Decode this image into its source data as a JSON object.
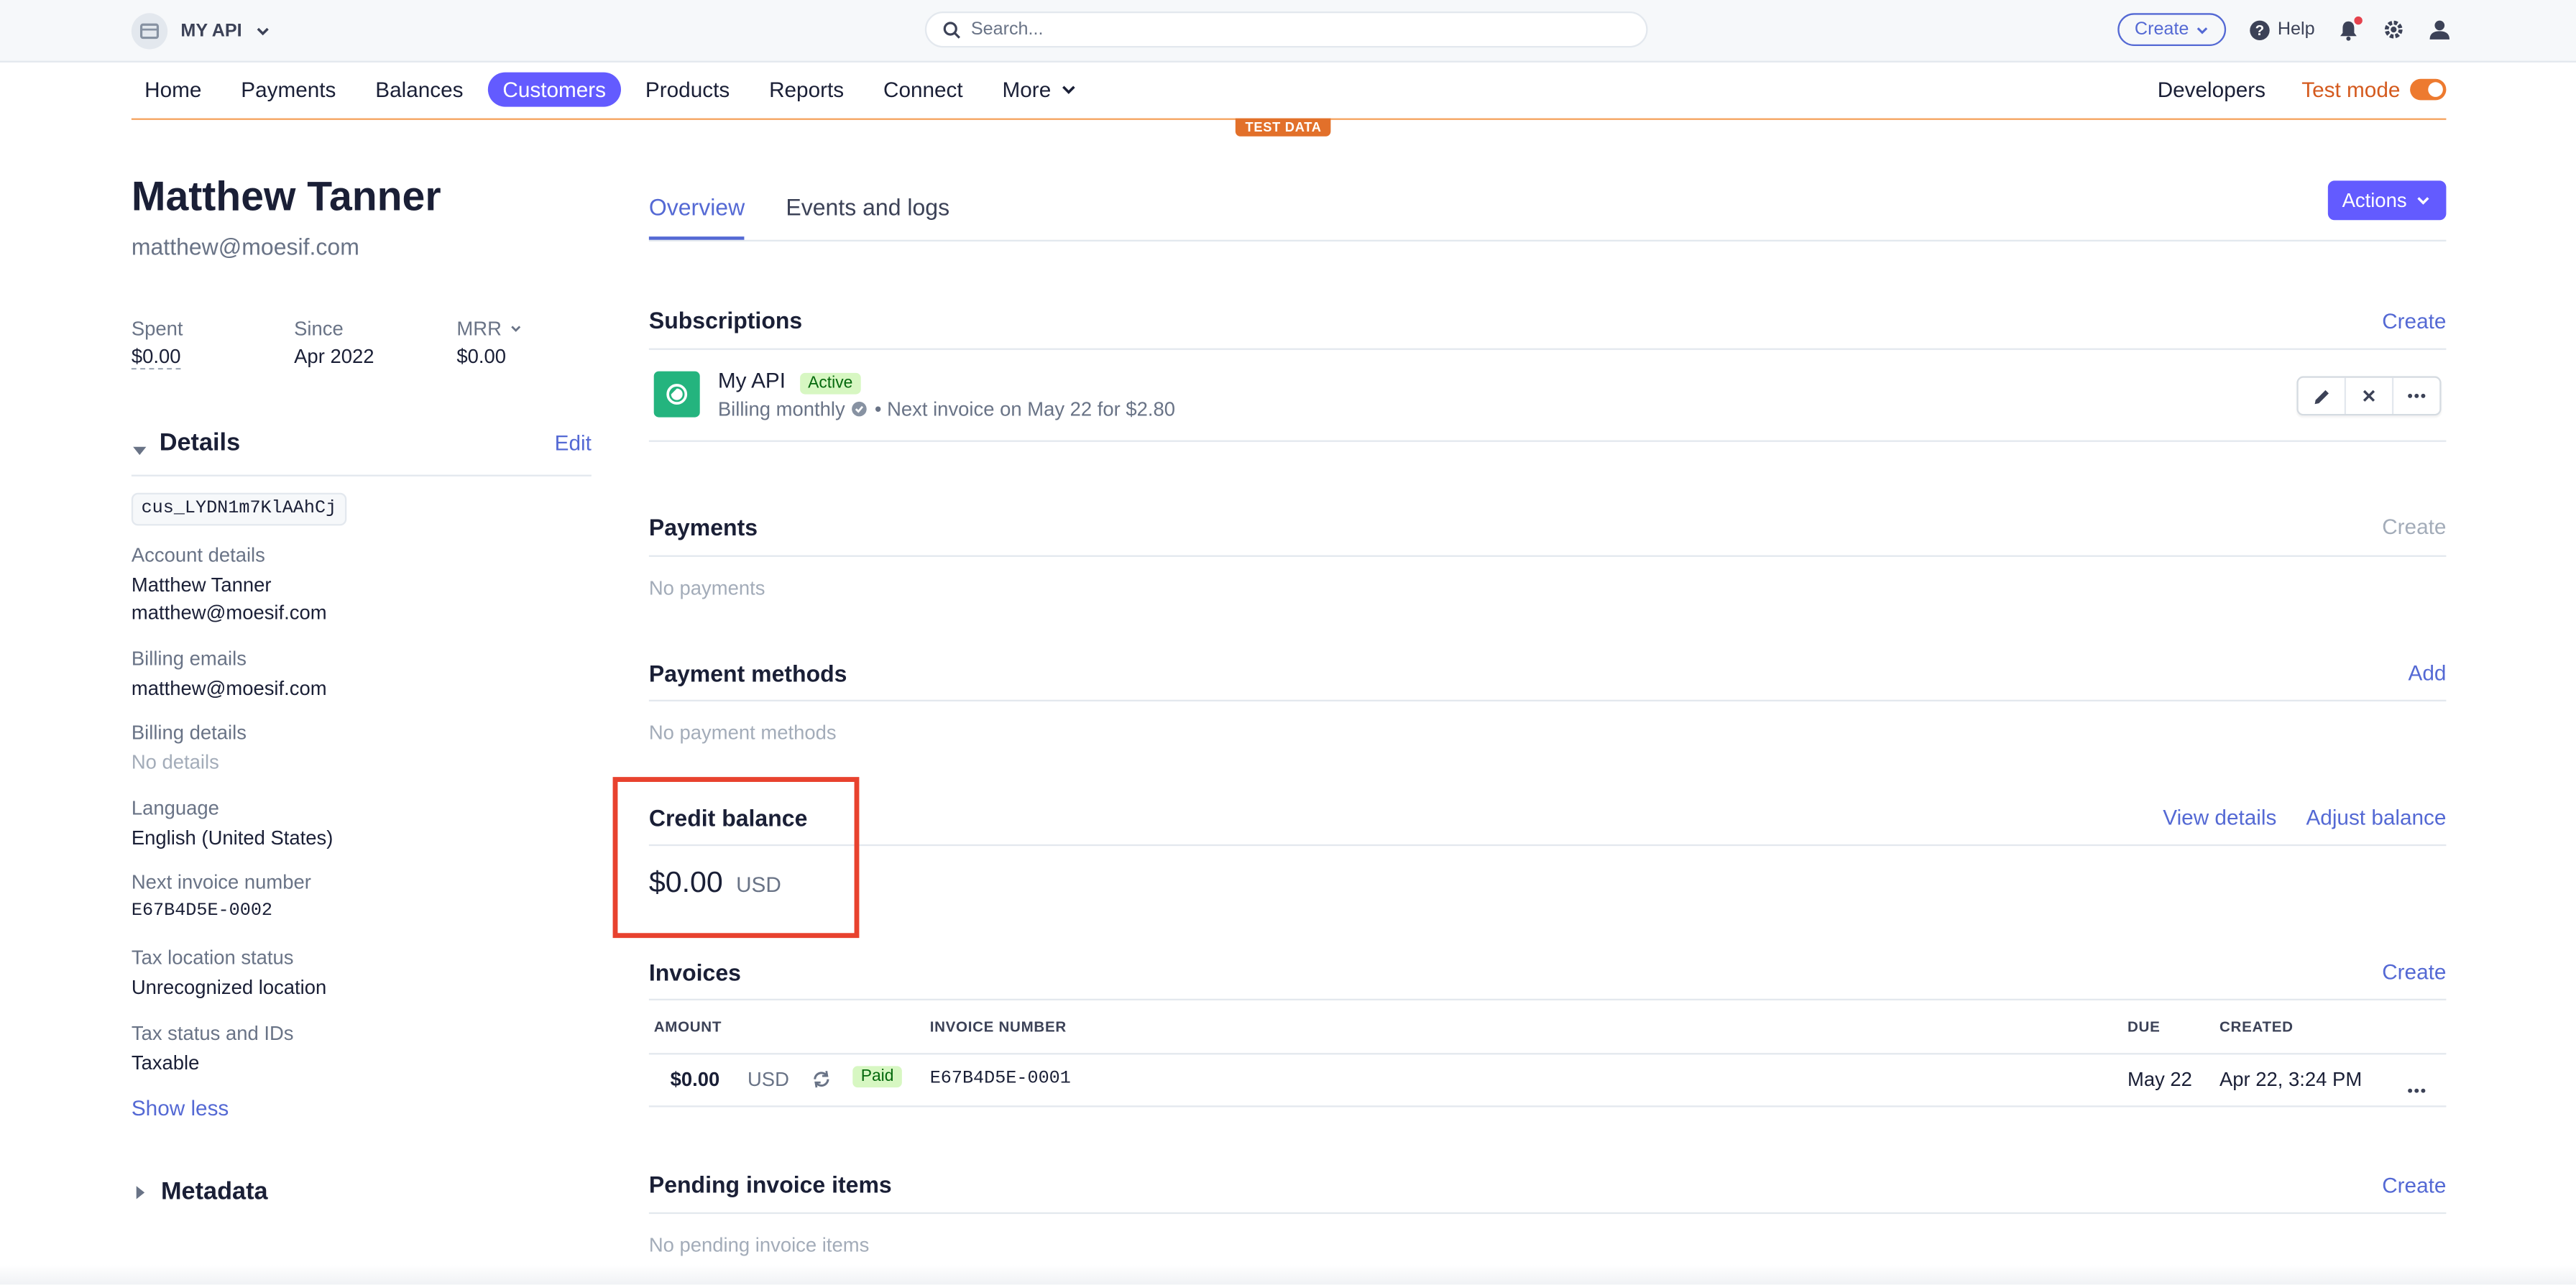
{
  "topbar": {
    "account_name": "MY API",
    "search_placeholder": "Search...",
    "create_label": "Create",
    "help_label": "Help"
  },
  "nav": {
    "items": [
      "Home",
      "Payments",
      "Balances",
      "Customers",
      "Products",
      "Reports",
      "Connect",
      "More"
    ],
    "active": "Customers",
    "developers_label": "Developers",
    "test_mode_label": "Test mode",
    "test_data_badge": "TEST DATA"
  },
  "customer": {
    "name": "Matthew Tanner",
    "email": "matthew@moesif.com",
    "stats": [
      {
        "label": "Spent",
        "value": "$0.00"
      },
      {
        "label": "Since",
        "value": "Apr 2022"
      },
      {
        "label": "MRR",
        "value": "$0.00"
      }
    ]
  },
  "details": {
    "title": "Details",
    "edit_label": "Edit",
    "customer_id": "cus_LYDN1m7KlAAhCj",
    "fields": [
      {
        "label": "Account details",
        "values": [
          "Matthew Tanner",
          "matthew@moesif.com"
        ]
      },
      {
        "label": "Billing emails",
        "values": [
          "matthew@moesif.com"
        ]
      },
      {
        "label": "Billing details",
        "values": [
          "No details"
        ]
      },
      {
        "label": "Language",
        "values": [
          "English (United States)"
        ]
      },
      {
        "label": "Next invoice number",
        "values": [
          "E67B4D5E-0002"
        ]
      },
      {
        "label": "Tax location status",
        "values": [
          "Unrecognized location"
        ]
      },
      {
        "label": "Tax status and IDs",
        "values": [
          "Taxable"
        ]
      }
    ],
    "show_less_label": "Show less",
    "metadata_title": "Metadata"
  },
  "tabs": {
    "overview": "Overview",
    "events": "Events and logs",
    "actions_label": "Actions"
  },
  "subscriptions": {
    "title": "Subscriptions",
    "create_label": "Create",
    "item": {
      "name": "My API",
      "status": "Active",
      "billing": "Billing monthly",
      "next_invoice": "• Next invoice on May 22 for $2.80"
    }
  },
  "payments": {
    "title": "Payments",
    "create_label": "Create",
    "empty": "No payments"
  },
  "payment_methods": {
    "title": "Payment methods",
    "add_label": "Add",
    "empty": "No payment methods"
  },
  "credit_balance": {
    "title": "Credit balance",
    "view_details_label": "View details",
    "adjust_label": "Adjust balance",
    "amount": "$0.00",
    "currency": "USD"
  },
  "invoices": {
    "title": "Invoices",
    "create_label": "Create",
    "columns": {
      "amount": "AMOUNT",
      "number": "INVOICE NUMBER",
      "due": "DUE",
      "created": "CREATED"
    },
    "rows": [
      {
        "amount": "$0.00",
        "currency": "USD",
        "status": "Paid",
        "number": "E67B4D5E-0001",
        "due": "May 22",
        "created": "Apr 22, 3:24 PM"
      }
    ]
  },
  "pending": {
    "title": "Pending invoice items",
    "create_label": "Create",
    "empty": "No pending invoice items"
  },
  "colors": {
    "accent": "#635bff",
    "link": "#5469d4",
    "test_mode": "#e2702a",
    "highlight": "#e8422e",
    "success_bg": "#d7f7c2"
  }
}
